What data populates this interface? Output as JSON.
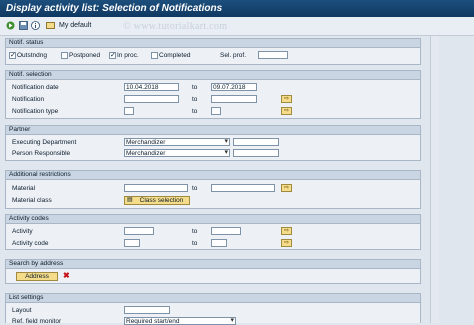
{
  "title": "Display activity list: Selection of Notifications",
  "watermark": "© www.tutorialkart.com",
  "toolbar": {
    "execute_icon": "execute-icon",
    "save_icon": "save-variant-icon",
    "info_icon": "info-icon",
    "my_default": "My default"
  },
  "notif_status": {
    "header": "Notif. status",
    "outstanding": {
      "label": "Outstndng",
      "checked": true
    },
    "postponed": {
      "label": "Postponed",
      "checked": false
    },
    "in_proc": {
      "label": "In proc.",
      "checked": true
    },
    "completed": {
      "label": "Completed",
      "checked": false
    },
    "sel_prof_label": "Sel. prof."
  },
  "notif_selection": {
    "header": "Notif. selection",
    "notification_date_label": "Notification date",
    "date_from": "10.04.2018",
    "to1": "to",
    "date_to": "09.07.2018",
    "notification_label": "Notification",
    "to2": "to",
    "notification_type_label": "Notification type",
    "to3": "to"
  },
  "partner": {
    "header": "Partner",
    "exec_dept_label": "Executing Department",
    "exec_dept_value": "Merchandizer_",
    "person_resp_label": "Person Responsible",
    "person_resp_value": "Merchandizer_"
  },
  "additional": {
    "header": "Additional restrictions",
    "material_label": "Material",
    "to": "to",
    "material_class_label": "Material class",
    "class_selection_button": "Class selection"
  },
  "activity_codes": {
    "header": "Activity codes",
    "activity_label": "Activity",
    "to1": "to",
    "activity_code_label": "Activity code",
    "to2": "to"
  },
  "search_by_address": {
    "header": "Search by address",
    "address_button": "Address"
  },
  "list_settings": {
    "header": "List settings",
    "layout_label": "Layout",
    "ref_field_monitor_label": "Ref. field monitor",
    "ref_field_monitor_value": "Required start/end"
  }
}
